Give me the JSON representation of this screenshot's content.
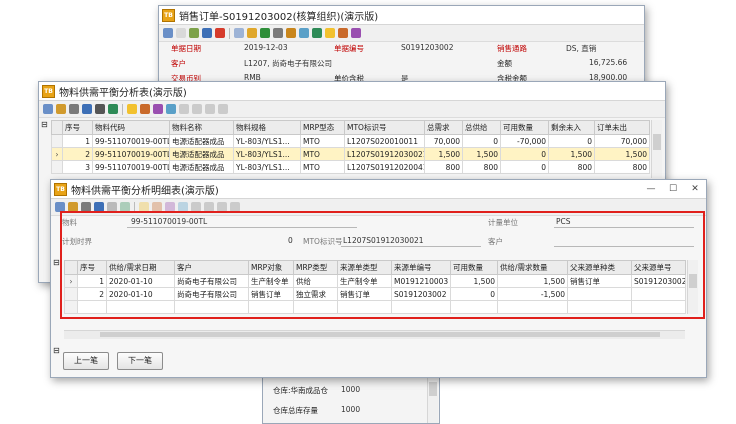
{
  "win1": {
    "title": "销售订单-S0191203002(核算组织)(演示版)",
    "labels": {
      "date": "单据日期",
      "order_no": "单据编号",
      "channel": "销售通路",
      "customer": "客户",
      "amount": "金额",
      "currency": "交易币别",
      "price_tax": "单价含税",
      "tax_amount": "含税金额"
    },
    "values": {
      "date": "2019-12-03",
      "order_no": "S0191203002",
      "channel": "DS, 直销",
      "customer": "L1207, 尚奇电子有限公司",
      "amount": "16,725.66",
      "currency": "RMB",
      "price_tax": "是",
      "tax_amount": "18,900.00"
    }
  },
  "win2": {
    "title": "物料供需平衡分析表(演示版)",
    "columns": [
      "序号",
      "物料代码",
      "物料名称",
      "物料规格",
      "MRP型态",
      "MTO标识号",
      "总需求",
      "总供给",
      "可用数量",
      "剩余未入",
      "订单未出"
    ],
    "rows": [
      [
        "1",
        "99-511070019-00TL",
        "电源适配器成品",
        "YL-803/YLS1...",
        "MTO",
        "L1207S020010011",
        "70,000",
        "0",
        "-70,000",
        "0",
        "70,000"
      ],
      [
        "2",
        "99-511070019-00TL",
        "电源适配器成品",
        "YL-803/YLS1...",
        "MTO",
        "L1207S01912030021",
        "1,500",
        "1,500",
        "0",
        "1,500",
        "1,500"
      ],
      [
        "3",
        "99-511070019-00TL",
        "电源适配器成品",
        "YL-803/YLS1...",
        "MTO",
        "L1207S01912020041",
        "800",
        "800",
        "0",
        "800",
        "800"
      ]
    ],
    "bottom": [
      {
        "label": "仓库:华南成品仓",
        "value": "1000"
      },
      {
        "label": "仓库总库存量",
        "value": "1000"
      }
    ]
  },
  "win3": {
    "title": "物料供需平衡分析明细表(演示版)",
    "header": {
      "material_label": "物料",
      "material_value": "99-511070019-00TL",
      "unit_label": "计量单位",
      "unit_value": "PCS",
      "plan_label": "计划时界",
      "plan_value": "0",
      "mto_label": "MTO标识号",
      "mto_value": "L1207S01912030021",
      "customer_label": "客户",
      "customer_value": ""
    },
    "columns": [
      "序号",
      "供给/需求日期",
      "客户",
      "MRP对象",
      "MRP类型",
      "来源单类型",
      "来源单编号",
      "可用数量",
      "供给/需求数量",
      "父来源单种类",
      "父来源单号"
    ],
    "rows": [
      [
        "1",
        "2020-01-10",
        "尚奇电子有限公司",
        "生产制令单",
        "供给",
        "生产制令单",
        "M0191210003",
        "1,500",
        "1,500",
        "销售订单",
        "S0191203002"
      ],
      [
        "2",
        "2020-01-10",
        "尚奇电子有限公司",
        "销售订单",
        "独立需求",
        "销售订单",
        "S0191203002",
        "0",
        "-1,500",
        "",
        ""
      ]
    ],
    "buttons": {
      "prev": "上一笔",
      "next": "下一笔"
    }
  },
  "colors": {
    "highlight": "#e0201c",
    "selected_row": "#fff3c4",
    "required_label": "#c00000"
  }
}
